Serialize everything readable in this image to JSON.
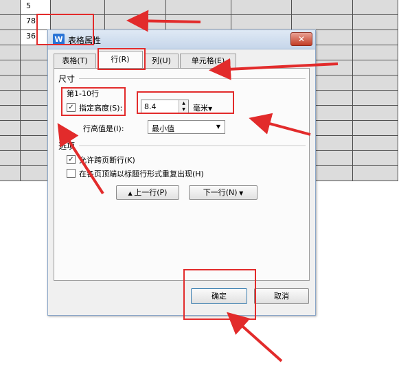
{
  "sheet": {
    "cells": [
      "5",
      "78",
      "36"
    ]
  },
  "dialog": {
    "title": "表格属性",
    "title_icon": "W",
    "close_glyph": "✕",
    "tabs": [
      "表格(T)",
      "行(R)",
      "列(U)",
      "单元格(E)"
    ],
    "size_section": "尺寸",
    "row_range": "第1-10行",
    "specify_height_label": "指定高度(S):",
    "height_value": "8.4",
    "unit_label": "毫米",
    "row_height_is_label": "行高值是(I):",
    "row_height_mode": "最小值",
    "options_section": "选项",
    "allow_break_label": "允许跨页断行(K)",
    "repeat_header_label": "在各页顶端以标题行形式重复出现(H)",
    "prev_row_label": "上一行(P)",
    "next_row_label": "下一行(N)",
    "ok_label": "确定",
    "cancel_label": "取消"
  },
  "colors": {
    "annotation": "#e22b2b",
    "accent": "#2a74d6"
  }
}
